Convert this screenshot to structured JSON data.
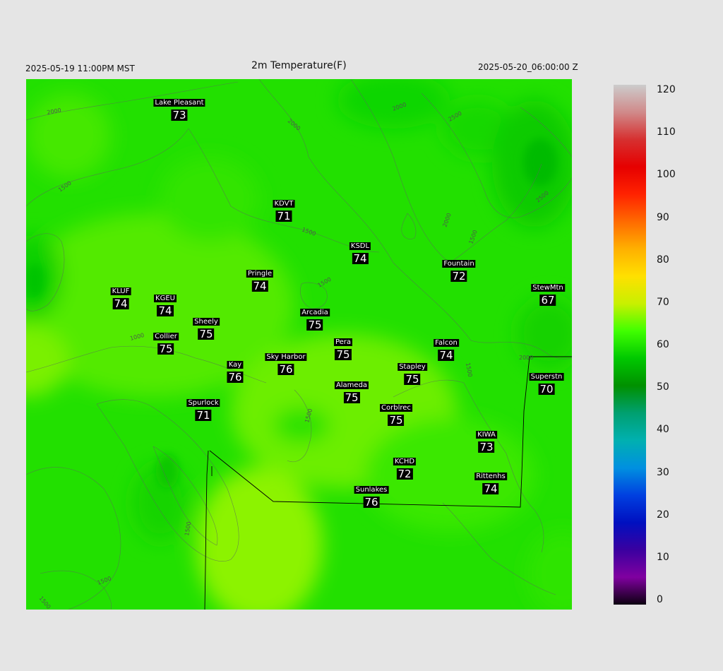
{
  "header": {
    "local_time": "2025-05-19 11:00PM MST",
    "title": "2m Temperature(F)",
    "utc_time": "2025-05-20_06:00:00 Z"
  },
  "contour_labels": [
    "2000",
    "2000",
    "2000",
    "2500",
    "2000",
    "2500",
    "1500",
    "1500",
    "1500",
    "1500",
    "1000",
    "1500",
    "2000",
    "1500",
    "1500",
    "1500",
    "1500"
  ],
  "stations": [
    {
      "name": "Lake Pleasant",
      "value": "73"
    },
    {
      "name": "KDVT",
      "value": "71"
    },
    {
      "name": "KSDL",
      "value": "74"
    },
    {
      "name": "Fountain",
      "value": "72"
    },
    {
      "name": "Pringle",
      "value": "74"
    },
    {
      "name": "KLUF",
      "value": "74"
    },
    {
      "name": "KGEU",
      "value": "74"
    },
    {
      "name": "StewMtn",
      "value": "67"
    },
    {
      "name": "Arcadia",
      "value": "75"
    },
    {
      "name": "Sheely",
      "value": "75"
    },
    {
      "name": "Collier",
      "value": "75"
    },
    {
      "name": "Pera",
      "value": "75"
    },
    {
      "name": "Falcon",
      "value": "74"
    },
    {
      "name": "Kay",
      "value": "76"
    },
    {
      "name": "Sky Harbor",
      "value": "76"
    },
    {
      "name": "Stapley",
      "value": "75"
    },
    {
      "name": "Superstn",
      "value": "70"
    },
    {
      "name": "Alameda",
      "value": "75"
    },
    {
      "name": "Spurlock",
      "value": "71"
    },
    {
      "name": "Corblrec",
      "value": "75"
    },
    {
      "name": "KIWA",
      "value": "73"
    },
    {
      "name": "KCHD",
      "value": "72"
    },
    {
      "name": "Rittenhs",
      "value": "74"
    },
    {
      "name": "Sunlakes",
      "value": "76"
    }
  ],
  "colorbar": {
    "ticks": [
      "120",
      "110",
      "100",
      "90",
      "80",
      "70",
      "60",
      "50",
      "40",
      "30",
      "20",
      "10",
      "0"
    ],
    "colors": [
      "#cccccc",
      "#d08a8a",
      "#d63030",
      "#e60000",
      "#ff2200",
      "#ff6a00",
      "#ffb000",
      "#ffe000",
      "#c8f000",
      "#40ff00",
      "#00c800",
      "#009000",
      "#00a070",
      "#00b0b0",
      "#0090e0",
      "#0040e0",
      "#0010c0",
      "#3a00a0",
      "#8000a0",
      "#0c0010"
    ]
  }
}
